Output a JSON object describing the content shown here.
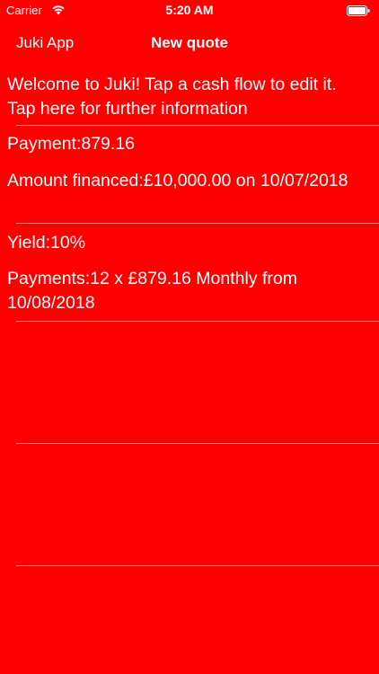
{
  "status_bar": {
    "carrier": "Carrier",
    "time": "5:20 AM"
  },
  "nav": {
    "back_label": "Juki App",
    "title": "New quote"
  },
  "rows": [
    {
      "text": "Welcome to Juki! Tap a cash flow to edit it.  Tap here for further information"
    },
    {
      "text": "Payment:879.16"
    },
    {
      "text": "Amount financed:£10,000.00 on 10/07/2018"
    },
    {
      "text": "Yield:10%"
    },
    {
      "text": "Payments:12 x £879.16 Monthly from 10/08/2018"
    }
  ],
  "colors": {
    "background": "#FF0000",
    "text": "#FFFFFF"
  }
}
